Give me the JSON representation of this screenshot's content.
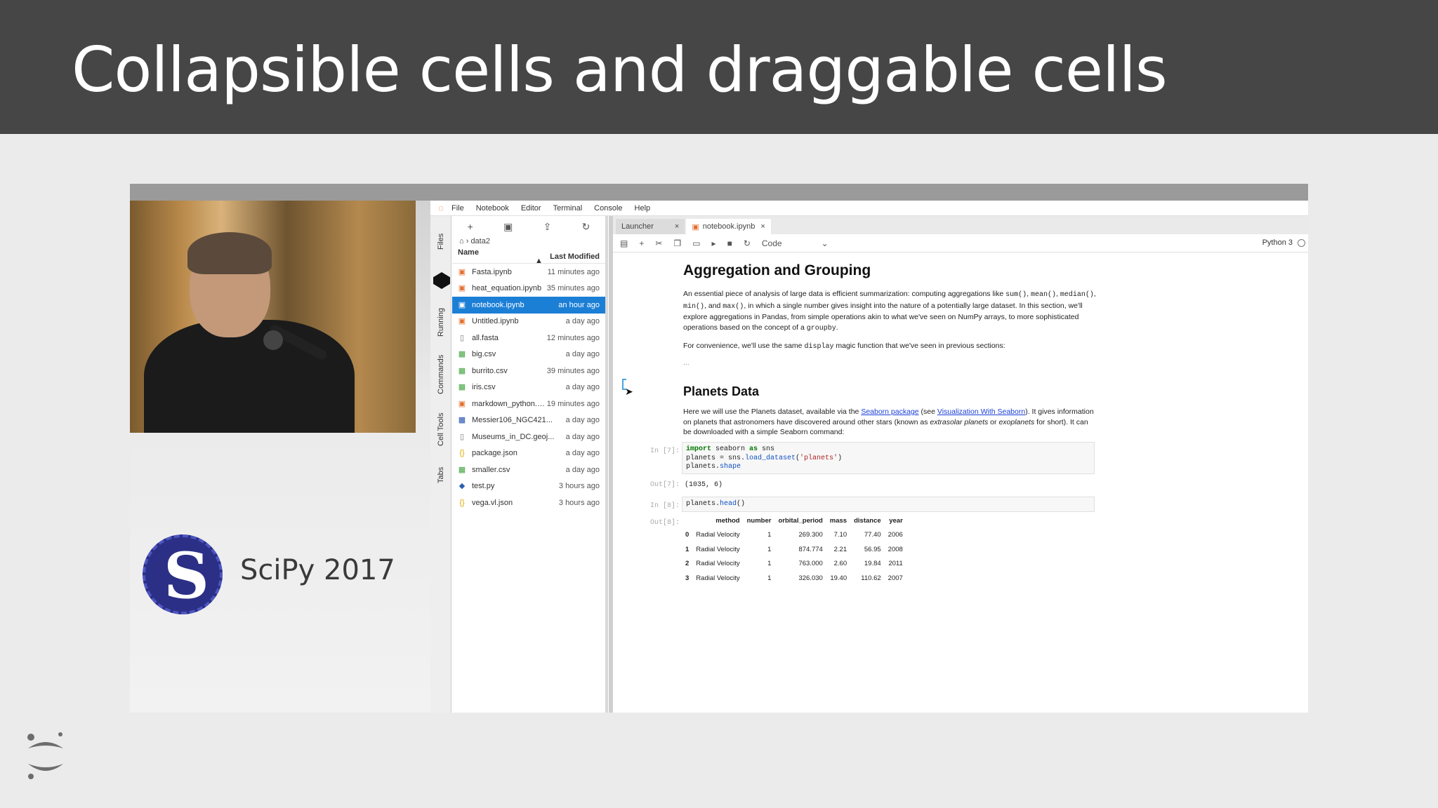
{
  "slide": {
    "title": "Collapsible cells and draggable cells",
    "conference": "SciPy 2017"
  },
  "menubar": {
    "items": [
      "File",
      "Notebook",
      "Editor",
      "Terminal",
      "Console",
      "Help"
    ]
  },
  "left_tabs": [
    "Files",
    "Running",
    "Commands",
    "Cell Tools",
    "Tabs"
  ],
  "file_browser": {
    "breadcrumb": "data2",
    "columns": {
      "name": "Name",
      "modified": "Last Modified"
    },
    "files": [
      {
        "name": "Fasta.ipynb",
        "modified": "11 minutes ago",
        "icon": "notebook-icon",
        "selected": false
      },
      {
        "name": "heat_equation.ipynb",
        "modified": "35 minutes ago",
        "icon": "notebook-icon",
        "selected": false
      },
      {
        "name": "notebook.ipynb",
        "modified": "an hour ago",
        "icon": "notebook-icon",
        "selected": true
      },
      {
        "name": "Untitled.ipynb",
        "modified": "a day ago",
        "icon": "notebook-icon",
        "selected": false
      },
      {
        "name": "all.fasta",
        "modified": "12 minutes ago",
        "icon": "file-icon",
        "selected": false
      },
      {
        "name": "big.csv",
        "modified": "a day ago",
        "icon": "spreadsheet-icon",
        "selected": false
      },
      {
        "name": "burrito.csv",
        "modified": "39 minutes ago",
        "icon": "spreadsheet-icon",
        "selected": false
      },
      {
        "name": "iris.csv",
        "modified": "a day ago",
        "icon": "spreadsheet-icon",
        "selected": false
      },
      {
        "name": "markdown_python.md",
        "modified": "19 minutes ago",
        "icon": "markdown-icon",
        "selected": false
      },
      {
        "name": "Messier106_NGC421...",
        "modified": "a day ago",
        "icon": "image-icon",
        "selected": false
      },
      {
        "name": "Museums_in_DC.geoj...",
        "modified": "a day ago",
        "icon": "file-icon",
        "selected": false
      },
      {
        "name": "package.json",
        "modified": "a day ago",
        "icon": "json-icon",
        "selected": false
      },
      {
        "name": "smaller.csv",
        "modified": "a day ago",
        "icon": "spreadsheet-icon",
        "selected": false
      },
      {
        "name": "test.py",
        "modified": "3 hours ago",
        "icon": "python-icon",
        "selected": false
      },
      {
        "name": "vega.vl.json",
        "modified": "3 hours ago",
        "icon": "json-icon",
        "selected": false
      }
    ]
  },
  "doc_tabs": [
    {
      "label": "Launcher",
      "active": false
    },
    {
      "label": "notebook.ipynb",
      "active": true
    }
  ],
  "notebook_toolbar": {
    "cell_type": "Code",
    "kernel": "Python 3"
  },
  "notebook": {
    "heading1": "Aggregation and Grouping",
    "para1_a": "An essential piece of analysis of large data is efficient summarization: computing aggregations like ",
    "para1_code1": "sum()",
    "para1_code2": "mean()",
    "para1_code3": "median()",
    "para1_code4": "min()",
    "para1_b": ", and ",
    "para1_code5": "max()",
    "para1_c": ", in which a single number gives insight into the nature of a potentially large dataset. In this section, we'll explore aggregations in Pandas, from simple operations akin to what we've seen on NumPy arrays, to more sophisticated operations based on the concept of a ",
    "para1_code6": "groupby",
    "para2_a": "For convenience, we'll use the same ",
    "para2_code": "display",
    "para2_b": " magic function that we've seen in previous sections:",
    "ellipsis": "...",
    "heading2": "Planets Data",
    "para3_a": "Here we will use the Planets dataset, available via the ",
    "para3_link1": "Seaborn package",
    "para3_b": " (see ",
    "para3_link2": "Visualization With Seaborn",
    "para3_c": "). It gives information on planets that astronomers have discovered around other stars (known as ",
    "para3_em1": "extrasolar planets",
    "para3_d": " or ",
    "para3_em2": "exoplanets",
    "para3_e": " for short). It can be downloaded with a simple Seaborn command:",
    "cell7": {
      "in_prompt": "In [7]:",
      "out_prompt": "Out[7]:",
      "code_l1_kw1": "import",
      "code_l1_mod": " seaborn ",
      "code_l1_kw2": "as",
      "code_l1_alias": " sns",
      "code_l2_a": "planets = sns.",
      "code_l2_fn": "load_dataset",
      "code_l2_b": "(",
      "code_l2_str": "'planets'",
      "code_l2_c": ")",
      "code_l3_a": "planets.",
      "code_l3_attr": "shape",
      "output": "(1035, 6)"
    },
    "cell8": {
      "in_prompt": "In [8]:",
      "out_prompt": "Out[8]:",
      "code_a": "planets.",
      "code_fn": "head",
      "code_b": "()",
      "table": {
        "columns": [
          "",
          "method",
          "number",
          "orbital_period",
          "mass",
          "distance",
          "year"
        ],
        "rows": [
          [
            "0",
            "Radial Velocity",
            "1",
            "269.300",
            "7.10",
            "77.40",
            "2006"
          ],
          [
            "1",
            "Radial Velocity",
            "1",
            "874.774",
            "2.21",
            "56.95",
            "2008"
          ],
          [
            "2",
            "Radial Velocity",
            "1",
            "763.000",
            "2.60",
            "19.84",
            "2011"
          ],
          [
            "3",
            "Radial Velocity",
            "1",
            "326.030",
            "19.40",
            "110.62",
            "2007"
          ]
        ]
      }
    }
  }
}
